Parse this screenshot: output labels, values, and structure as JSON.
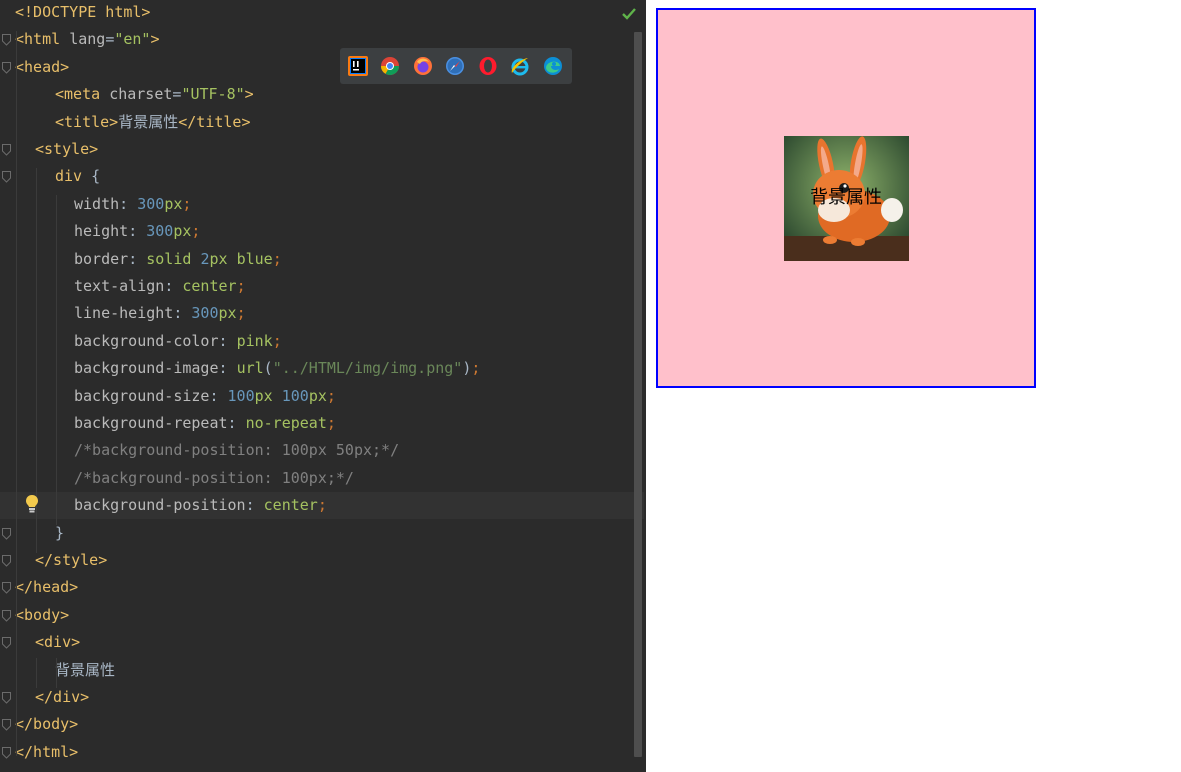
{
  "editor": {
    "lines": [
      [
        {
          "t": "<!DOCTYPE html>",
          "c": "tag"
        }
      ],
      [
        {
          "t": "<html ",
          "c": "tag"
        },
        {
          "t": "lang",
          "c": "attr"
        },
        {
          "t": "=",
          "c": "text"
        },
        {
          "t": "\"en\"",
          "c": "str"
        },
        {
          "t": ">",
          "c": "tag"
        }
      ],
      [
        {
          "t": "<head>",
          "c": "tag"
        }
      ],
      [
        {
          "t": "<meta ",
          "c": "tag"
        },
        {
          "t": "charset",
          "c": "attr"
        },
        {
          "t": "=",
          "c": "text"
        },
        {
          "t": "\"UTF-8\"",
          "c": "str"
        },
        {
          "t": ">",
          "c": "tag"
        }
      ],
      [
        {
          "t": "<title>",
          "c": "tag"
        },
        {
          "t": "背景属性",
          "c": "text"
        },
        {
          "t": "</title>",
          "c": "tag"
        }
      ],
      [
        {
          "t": "<style>",
          "c": "tag"
        }
      ],
      [
        {
          "t": "div ",
          "c": "sel"
        },
        {
          "t": "{",
          "c": "brace"
        }
      ],
      [
        {
          "t": "width",
          "c": "prop"
        },
        {
          "t": ": ",
          "c": "text"
        },
        {
          "t": "300",
          "c": "num"
        },
        {
          "t": "px",
          "c": "unit"
        },
        {
          "t": ";",
          "c": "semi"
        }
      ],
      [
        {
          "t": "height",
          "c": "prop"
        },
        {
          "t": ": ",
          "c": "text"
        },
        {
          "t": "300",
          "c": "num"
        },
        {
          "t": "px",
          "c": "unit"
        },
        {
          "t": ";",
          "c": "semi"
        }
      ],
      [
        {
          "t": "border",
          "c": "prop"
        },
        {
          "t": ": ",
          "c": "text"
        },
        {
          "t": "solid ",
          "c": "kw"
        },
        {
          "t": "2",
          "c": "num"
        },
        {
          "t": "px ",
          "c": "unit"
        },
        {
          "t": "blue",
          "c": "kw"
        },
        {
          "t": ";",
          "c": "semi"
        }
      ],
      [
        {
          "t": "text-align",
          "c": "prop"
        },
        {
          "t": ": ",
          "c": "text"
        },
        {
          "t": "center",
          "c": "kw"
        },
        {
          "t": ";",
          "c": "semi"
        }
      ],
      [
        {
          "t": "line-height",
          "c": "prop"
        },
        {
          "t": ": ",
          "c": "text"
        },
        {
          "t": "300",
          "c": "num"
        },
        {
          "t": "px",
          "c": "unit"
        },
        {
          "t": ";",
          "c": "semi"
        }
      ],
      [
        {
          "t": "background-color",
          "c": "prop"
        },
        {
          "t": ": ",
          "c": "text"
        },
        {
          "t": "pink",
          "c": "kw"
        },
        {
          "t": ";",
          "c": "semi"
        }
      ],
      [
        {
          "t": "background-image",
          "c": "prop"
        },
        {
          "t": ": ",
          "c": "text"
        },
        {
          "t": "url",
          "c": "url"
        },
        {
          "t": "(",
          "c": "paren"
        },
        {
          "t": "\"../HTML/img/img.png\"",
          "c": "urlstr"
        },
        {
          "t": ")",
          "c": "paren"
        },
        {
          "t": ";",
          "c": "semi"
        }
      ],
      [
        {
          "t": "background-size",
          "c": "prop"
        },
        {
          "t": ": ",
          "c": "text"
        },
        {
          "t": "100",
          "c": "num"
        },
        {
          "t": "px ",
          "c": "unit"
        },
        {
          "t": "100",
          "c": "num"
        },
        {
          "t": "px",
          "c": "unit"
        },
        {
          "t": ";",
          "c": "semi"
        }
      ],
      [
        {
          "t": "background-repeat",
          "c": "prop"
        },
        {
          "t": ": ",
          "c": "text"
        },
        {
          "t": "no-repeat",
          "c": "kw"
        },
        {
          "t": ";",
          "c": "semi"
        }
      ],
      [
        {
          "t": "/*background-position: 100px 50px;*/",
          "c": "comment"
        }
      ],
      [
        {
          "t": "/*background-position: 100px;*/",
          "c": "comment"
        }
      ],
      [
        {
          "t": "background-position",
          "c": "prop"
        },
        {
          "t": ": ",
          "c": "text"
        },
        {
          "t": "center",
          "c": "kw"
        },
        {
          "t": ";",
          "c": "semi"
        }
      ],
      [
        {
          "t": "}",
          "c": "brace"
        }
      ],
      [
        {
          "t": "</style>",
          "c": "tag"
        }
      ],
      [
        {
          "t": "</head>",
          "c": "tag"
        }
      ],
      [
        {
          "t": "<body>",
          "c": "tag"
        }
      ],
      [
        {
          "t": "<div>",
          "c": "tag"
        }
      ],
      [
        {
          "t": "背景属性",
          "c": "text"
        }
      ],
      [
        {
          "t": "</div>",
          "c": "tag"
        }
      ],
      [
        {
          "t": "</body>",
          "c": "tag"
        }
      ],
      [
        {
          "t": "</html>",
          "c": "tag"
        }
      ]
    ],
    "current_line": 19
  },
  "browser_bar": {
    "icons": [
      "intellij-icon",
      "chrome-icon",
      "firefox-icon",
      "safari-icon",
      "opera-icon",
      "ie-icon",
      "edge-icon"
    ]
  },
  "preview": {
    "div_text": "背景属性",
    "colors": {
      "border": "#0000ff",
      "background": "#ffc0cb"
    }
  }
}
